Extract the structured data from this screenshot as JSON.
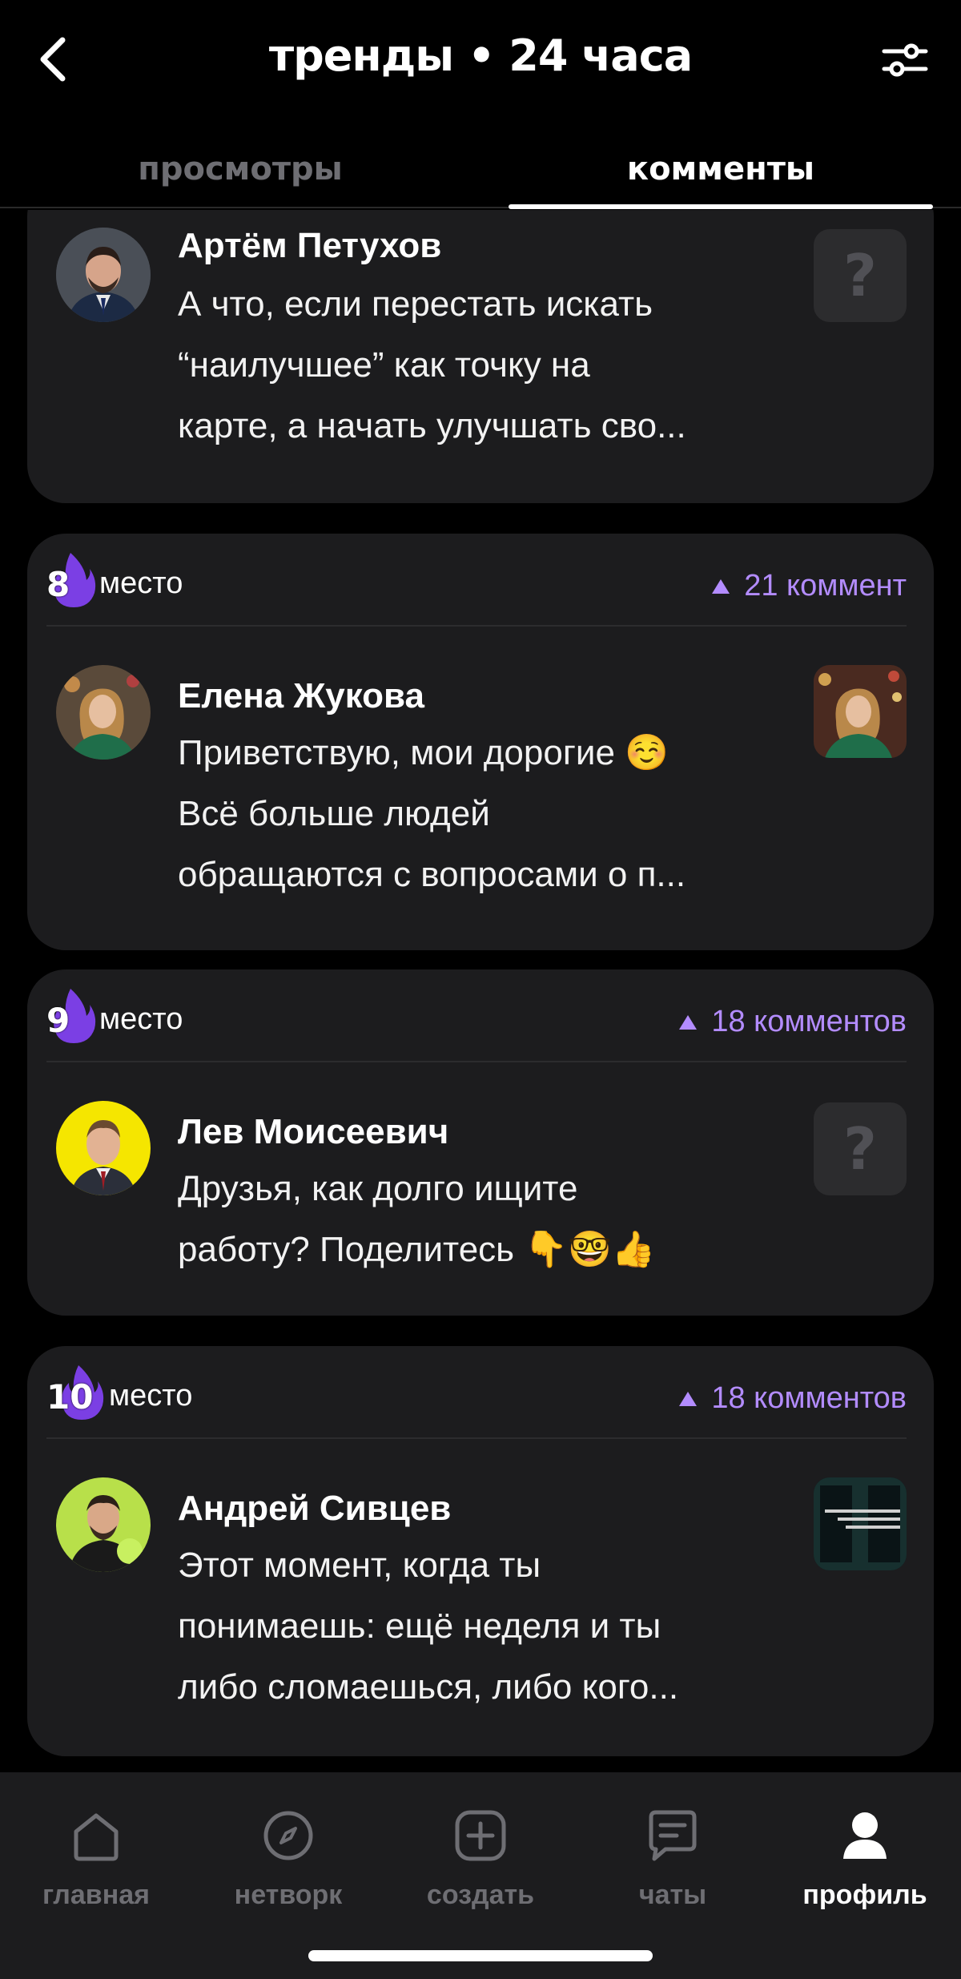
{
  "header": {
    "title": "тренды • 24 часа",
    "back_icon": "chevron-left-icon",
    "filter_icon": "sliders-icon"
  },
  "tabs": [
    {
      "label": "просмотры",
      "active": false
    },
    {
      "label": "комменты",
      "active": true
    }
  ],
  "feed": {
    "partial_card": {
      "author": "Артём Петухов",
      "text_lines": [
        "А что, если перестать искать",
        "“наилучшее” как точку на",
        "карте, а начать улучшать сво..."
      ],
      "thumb": "?"
    },
    "cards": [
      {
        "rank": "8",
        "rank_label": "место",
        "count": "21 коммент",
        "author": "Елена Жукова",
        "text_lines": [
          "Приветствую, мои дорогие ☺️",
          "Всё больше людей",
          "обращаются с вопросами о п..."
        ]
      },
      {
        "rank": "9",
        "rank_label": "место",
        "count": "18 комментов",
        "author": "Лев Моисеевич",
        "text_lines": [
          "Друзья, как долго ищите",
          "работу? Поделитесь 👇🤓👍"
        ],
        "thumb": "?"
      },
      {
        "rank": "10",
        "rank_label": "место",
        "count": "18 комментов",
        "author": "Андрей Сивцев",
        "text_lines": [
          "Этот момент, когда ты",
          "понимаешь: ещё неделя  и ты",
          "либо сломаешься, либо кого..."
        ]
      }
    ]
  },
  "nav": [
    {
      "label": "главная",
      "icon": "home-icon"
    },
    {
      "label": "нетворк",
      "icon": "compass-icon"
    },
    {
      "label": "создать",
      "icon": "plus-square-icon"
    },
    {
      "label": "чаты",
      "icon": "chat-icon"
    },
    {
      "label": "профиль",
      "icon": "profile-icon",
      "active": true
    }
  ],
  "colors": {
    "accent": "#b38cff",
    "card_bg": "#1c1c1e",
    "inactive": "#6e6e73",
    "flame": "#7b3fe4"
  }
}
